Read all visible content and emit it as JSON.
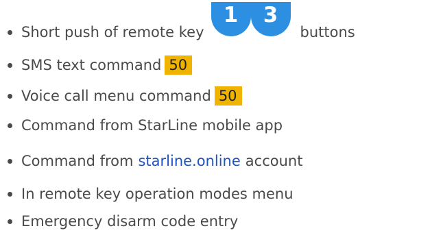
{
  "items": [
    {
      "text": "Short push of  remote key",
      "keys": [
        "1",
        "3"
      ],
      "after": "buttons"
    },
    {
      "text": "SMS text command",
      "code": "50"
    },
    {
      "text": "Voice call menu command",
      "code": "50"
    },
    {
      "text": "Command from StarLine mobile app"
    },
    {
      "before": "Command from",
      "link": "starline.online",
      "after": "account"
    },
    {
      "text": "In remote key operation modes menu"
    },
    {
      "text": "Emergency disarm code entry"
    }
  ],
  "colors": {
    "text": "#4a4a4a",
    "bullet": "#4a4a4a",
    "badge": "#f0b400",
    "link": "#1f55c2",
    "key": "#2c8fe1"
  }
}
